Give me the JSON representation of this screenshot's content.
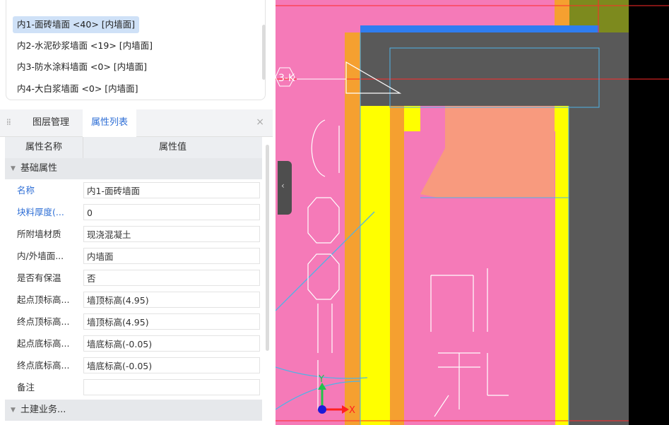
{
  "component_list": {
    "items": [
      {
        "label": "内1-面砖墙面 <40> [内墙面]",
        "selected": true
      },
      {
        "label": "内2-水泥砂浆墙面 <19> [内墙面]",
        "selected": false
      },
      {
        "label": "内3-防水涂料墙面 <0> [内墙面]",
        "selected": false
      },
      {
        "label": "内4-大白浆墙面 <0> [内墙面]",
        "selected": false
      }
    ]
  },
  "tabs": {
    "layer": "图层管理",
    "props": "属性列表",
    "close": "×"
  },
  "property_grid": {
    "col_name": "属性名称",
    "col_value": "属性值",
    "group_basic": "基础属性",
    "group_civil": "土建业务...",
    "rows": [
      {
        "key": "名称",
        "value": "内1-面砖墙面",
        "blue": true
      },
      {
        "key": "块料厚度(...",
        "value": "0",
        "blue": true
      },
      {
        "key": "所附墙材质",
        "value": "现浇混凝土",
        "blue": false
      },
      {
        "key": "内/外墙面...",
        "value": "内墙面",
        "blue": false
      },
      {
        "key": "是否有保温",
        "value": "否",
        "blue": false
      },
      {
        "key": "起点顶标高...",
        "value": "墙顶标高(4.95)",
        "blue": false
      },
      {
        "key": "终点顶标高...",
        "value": "墙顶标高(4.95)",
        "blue": false
      },
      {
        "key": "起点底标高...",
        "value": "墙底标高(-0.05)",
        "blue": false
      },
      {
        "key": "终点底标高...",
        "value": "墙底标高(-0.05)",
        "blue": false
      },
      {
        "key": "备注",
        "value": "",
        "blue": false
      }
    ]
  },
  "cad": {
    "axis_tag": "3-K",
    "axis_x": "X",
    "axis_y": "Y"
  },
  "colors": {
    "pink": "#f57ab8",
    "yellow": "#ffff00",
    "orange": "#f5a030",
    "dark": "#595959",
    "accent_blue": "#2f6fd6"
  }
}
